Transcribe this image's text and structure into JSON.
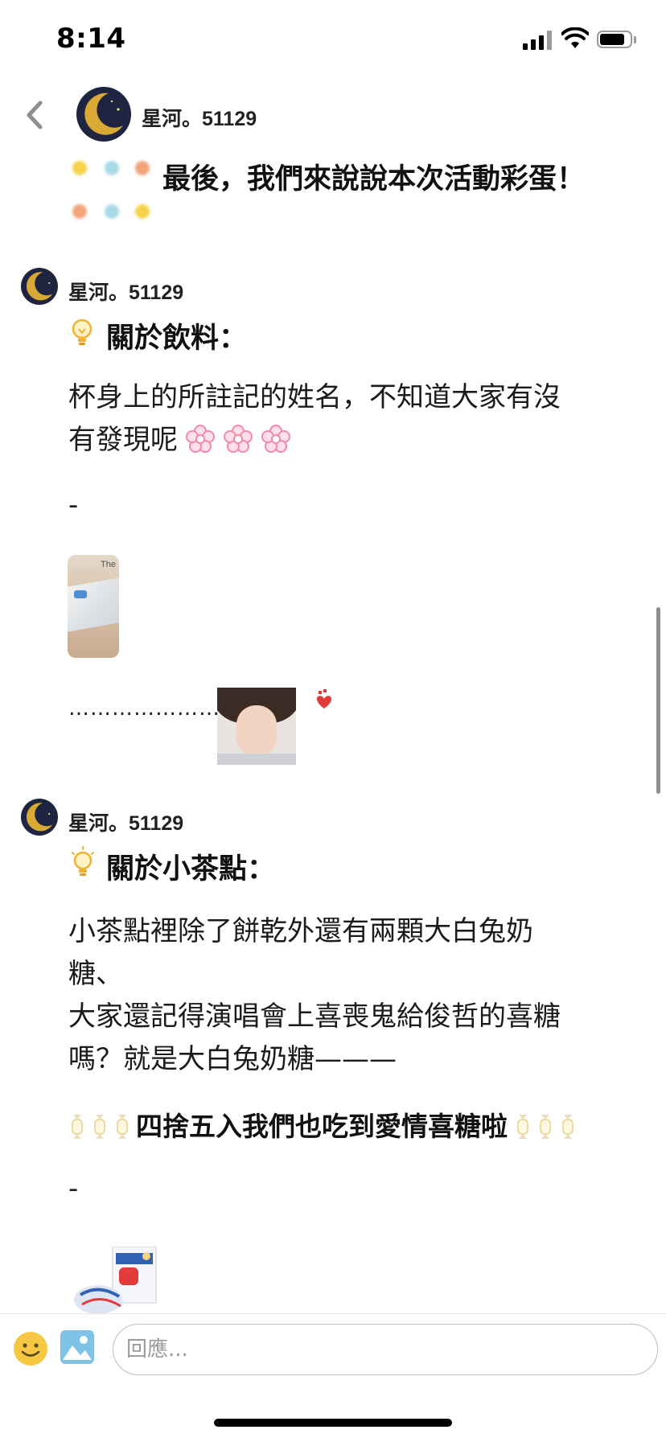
{
  "status_bar": {
    "time": "8:14"
  },
  "header": {
    "username": "星河。51129"
  },
  "intro": {
    "text": "最後，我們來說說本次活動彩蛋！"
  },
  "posts": [
    {
      "username": "星河。51129",
      "title": "關於飲料：",
      "body_lines": [
        "杯身上的所註記的姓名，不知道大家有沒",
        "有發現呢"
      ],
      "separator": "-",
      "image_caption": "The",
      "ellipsis": "…………………"
    },
    {
      "username": "星河。51129",
      "title": "關於小茶點：",
      "body_lines": [
        "小茶點裡除了餅乾外還有兩顆大白兔奶",
        "糖、",
        "大家還記得演唱會上喜喪鬼給俊哲的喜糖",
        "嗎？就是大白兔奶糖———"
      ],
      "highlight": "四捨五入我們也吃到愛情喜糖啦",
      "separator": "-"
    }
  ],
  "reply": {
    "placeholder": "回應..."
  },
  "icons": {
    "back": "chevron-left-icon",
    "emoji": "smiley-icon",
    "image": "image-icon",
    "bulb": "lightbulb-icon",
    "flower": "flower-icon",
    "heart": "heart-icon",
    "candy": "candy-icon"
  },
  "colors": {
    "moon_bg": "#1f2440",
    "moon_gold": "#d9a936",
    "emoji_yellow": "#f6c842",
    "image_blue": "#7fc2e8",
    "flower_pink": "#f08aa8"
  }
}
